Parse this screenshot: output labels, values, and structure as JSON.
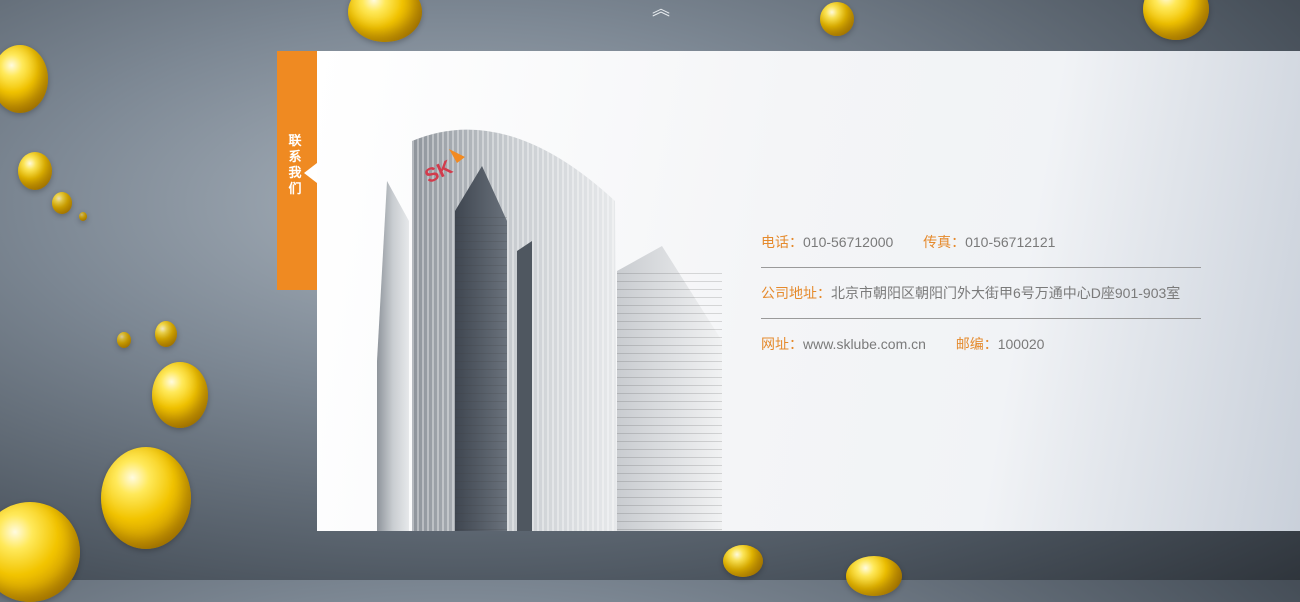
{
  "nav": {
    "up_icon": "double-chevron-up-icon"
  },
  "tab": {
    "label": "联系我们"
  },
  "building": {
    "logo_text": "SK"
  },
  "contact": {
    "phone_label": "电话：",
    "phone_value": "010-56712000",
    "fax_label": "传真：",
    "fax_value": "010-56712121",
    "address_label": "公司地址：",
    "address_value": "北京市朝阳区朝阳门外大街甲6号万通中心D座901-903室",
    "website_label": "网址：",
    "website_value": "www.sklube.com.cn",
    "postcode_label": "邮编：",
    "postcode_value": "100020"
  },
  "colors": {
    "accent": "#ef8a22",
    "label": "#e58a2c",
    "text": "#7a7a7a"
  }
}
